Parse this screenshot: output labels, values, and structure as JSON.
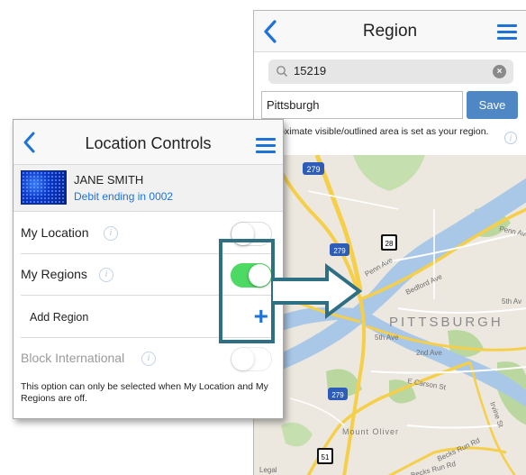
{
  "region_screen": {
    "title": "Region",
    "search_value": "15219",
    "city_value": "Pittsburgh",
    "save_label": "Save",
    "note": "Approximate visible/outlined area is set as your region.",
    "map": {
      "city_label": "PITTSBURGH",
      "road_labels": [
        "Penn Ave",
        "Penn Ave",
        "Bedford Ave",
        "5th Ave",
        "5th Av",
        "2nd Ave",
        "E Carson St",
        "Irvine St",
        "Becks Run Rd",
        "Becks Run Rd",
        "Mount Oliver"
      ],
      "route_shields": [
        "279",
        "279",
        "28",
        "279",
        "51"
      ],
      "legal": "Legal"
    }
  },
  "location_controls": {
    "title": "Location Controls",
    "card": {
      "name": "JANE SMITH",
      "debit": "Debit ending in 0002"
    },
    "rows": [
      {
        "label": "My Location",
        "toggle": "off"
      },
      {
        "label": "My Regions",
        "toggle": "on"
      },
      {
        "label": "Add Region",
        "action_icon": "plus-icon"
      },
      {
        "label": "Block International",
        "toggle": "off",
        "disabled": true
      }
    ],
    "footnote": "This option can only be selected when My Location and My Regions are off."
  },
  "colors": {
    "accent_blue": "#1d73d8",
    "toggle_on": "#4cd964",
    "highlight": "#2f6f84",
    "save_button": "#4f86c4"
  }
}
